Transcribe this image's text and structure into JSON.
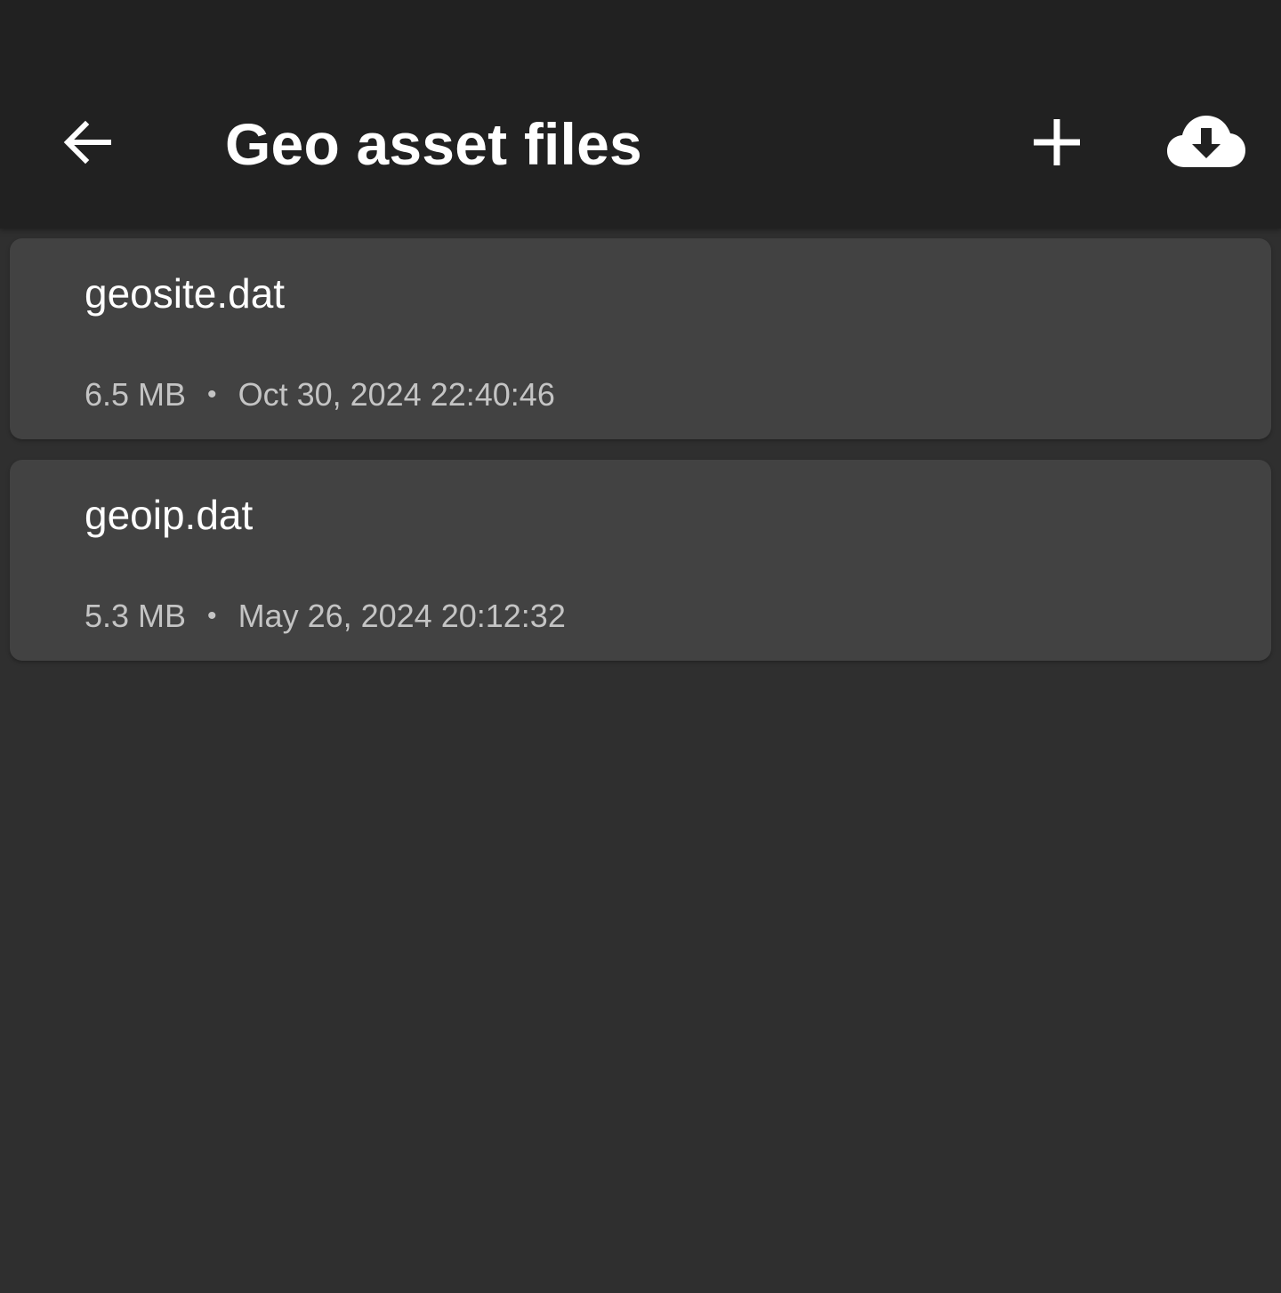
{
  "app_bar": {
    "title": "Geo asset files",
    "icons": {
      "back": "arrow-left-icon",
      "add": "plus-icon",
      "download": "cloud-download-icon"
    }
  },
  "files": [
    {
      "name": "geosite.dat",
      "size": "6.5 MB",
      "separator": "•",
      "modified": "Oct 30, 2024 22:40:46"
    },
    {
      "name": "geoip.dat",
      "size": "5.3 MB",
      "separator": "•",
      "modified": "May 26, 2024 20:12:32"
    }
  ],
  "colors": {
    "app_bar_bg": "#212121",
    "page_bg": "#2f2f2f",
    "card_bg": "#424242",
    "primary_text": "#ffffff",
    "secondary_text": "#c4c4c4"
  }
}
